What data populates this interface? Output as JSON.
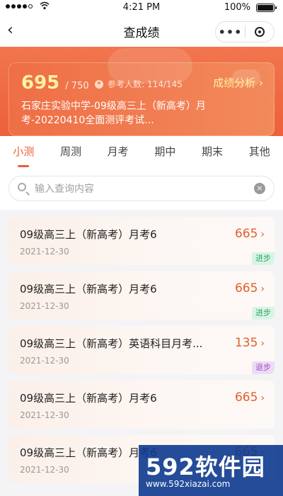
{
  "status_bar": {
    "time": "4:21 PM",
    "battery_percent": "100%",
    "wifi_icon": "wifi-icon"
  },
  "nav": {
    "back_icon": "‹",
    "title": "查成绩",
    "more_icon": "•••"
  },
  "score_card": {
    "score": "695",
    "total": "/ 750",
    "participants_label": "参考人数:",
    "participants_value": "114/145",
    "analysis_link": "成绩分析 ›",
    "exam_title": "石家庄实验中学-09级高三上（新高考）月考-20220410全面测评考试..."
  },
  "tabs": [
    {
      "label": "小测",
      "active": true
    },
    {
      "label": "周测",
      "active": false
    },
    {
      "label": "月考",
      "active": false
    },
    {
      "label": "期中",
      "active": false
    },
    {
      "label": "期末",
      "active": false
    },
    {
      "label": "其他",
      "active": false
    }
  ],
  "search": {
    "placeholder": "输入查询内容",
    "clear_icon": "×"
  },
  "exams": [
    {
      "name": "09级高三上（新高考）月考6",
      "date": "2021-12-30",
      "score": "665",
      "badge": "进步",
      "badge_type": "up"
    },
    {
      "name": "09级高三上（新高考）月考6",
      "date": "2021-12-30",
      "score": "665",
      "badge": "进步",
      "badge_type": "up"
    },
    {
      "name": "09级高三上（新高考）英语科目月考...",
      "date": "2021-12-30",
      "score": "135",
      "badge": "退步",
      "badge_type": "down"
    },
    {
      "name": "09级高三上（新高考）月考6",
      "date": "2021-12-30",
      "score": "665",
      "badge": "",
      "badge_type": ""
    },
    {
      "name": "09级高三上（新高考）月考6",
      "date": "2021-12-30",
      "score": "665",
      "badge": "",
      "badge_type": ""
    }
  ],
  "watermark": {
    "logo": "592软件园",
    "url": "www.592xiazai.com"
  },
  "colors": {
    "accent": "#e8603a",
    "card_gradient_start": "#ef6e45",
    "score_highlight": "#fff3a0"
  }
}
